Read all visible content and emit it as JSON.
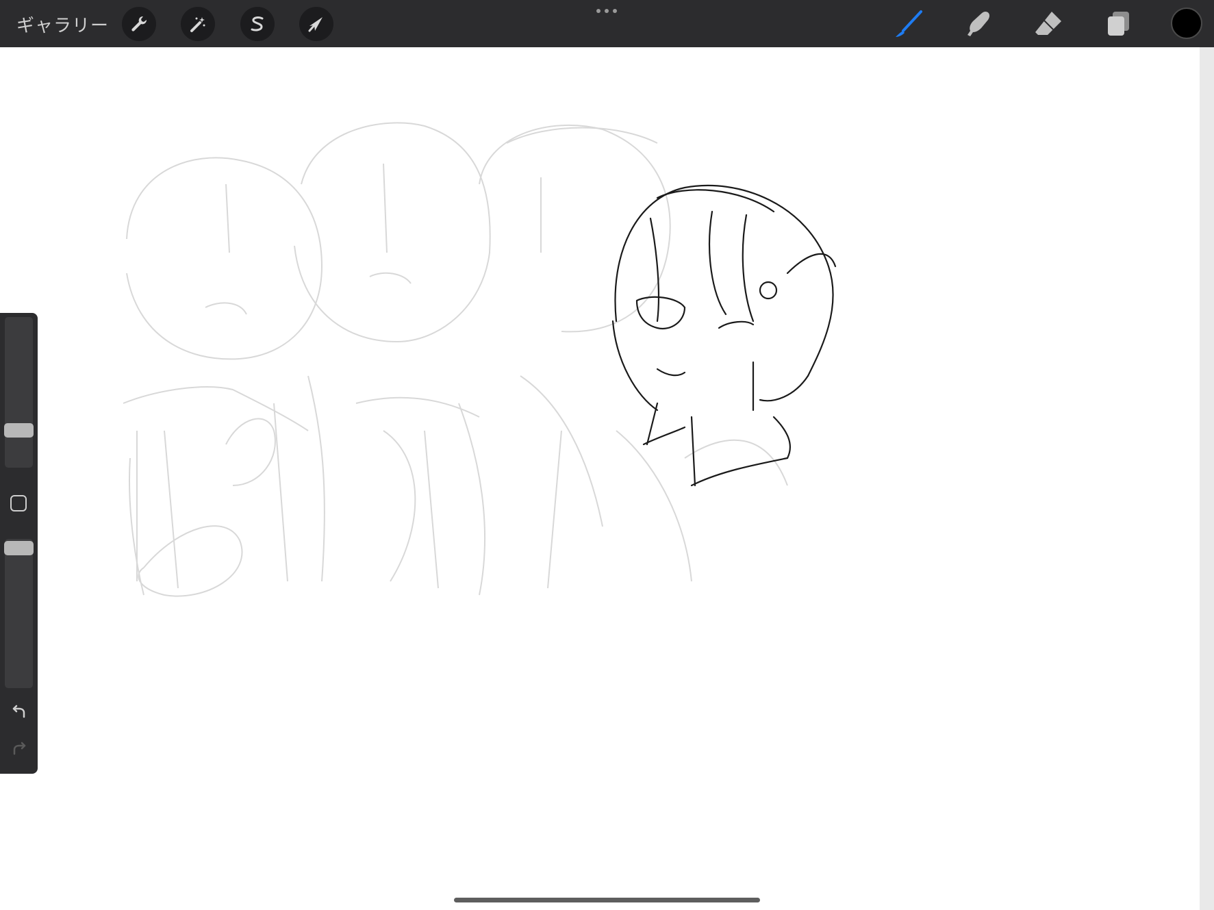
{
  "toolbar": {
    "gallery_label": "ギャラリー",
    "left_tools": [
      {
        "name": "actions",
        "icon": "wrench-icon"
      },
      {
        "name": "adjustments",
        "icon": "magic-wand-icon"
      },
      {
        "name": "selection",
        "icon": "selection-s-icon"
      },
      {
        "name": "transform",
        "icon": "arrow-cursor-icon"
      }
    ],
    "more_icon": "ellipsis-icon",
    "right_tools": [
      {
        "name": "brush",
        "icon": "brush-icon",
        "active": true,
        "color": "#1e7cf2"
      },
      {
        "name": "smudge",
        "icon": "smudge-icon",
        "active": false
      },
      {
        "name": "eraser",
        "icon": "eraser-icon",
        "active": false
      },
      {
        "name": "layers",
        "icon": "layers-icon",
        "active": false
      }
    ],
    "current_color": "#000000"
  },
  "sidebar": {
    "brush_size_level": 0.15,
    "opacity_level": 0.93,
    "modify_icon": "square-icon",
    "undo_icon": "undo-icon",
    "redo_icon": "redo-icon"
  },
  "colors": {
    "toolbar_bg": "#2c2c2e",
    "accent": "#1e7cf2",
    "canvas": "#ffffff"
  }
}
